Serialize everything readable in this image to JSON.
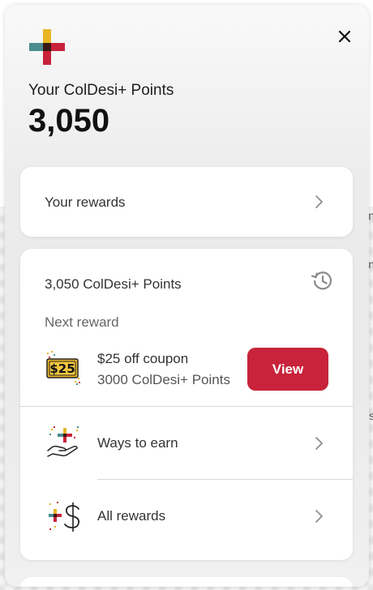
{
  "header": {
    "points_label": "Your ColDesi+ Points",
    "points_value": "3,050"
  },
  "rewards_card": {
    "label": "Your rewards"
  },
  "points_card": {
    "points_summary": "3,050 ColDesi+ Points",
    "next_reward_label": "Next reward",
    "coupon": {
      "badge_text": "$25",
      "title": "$25 off coupon",
      "cost": "3000 ColDesi+ Points",
      "button_label": "View"
    },
    "links": [
      {
        "label": "Ways to earn"
      },
      {
        "label": "All rewards"
      }
    ]
  },
  "colors": {
    "brand_red": "#c8233a",
    "brand_teal": "#4b8c91",
    "brand_yellow": "#e8b526",
    "brand_dark": "#3a1a14"
  }
}
